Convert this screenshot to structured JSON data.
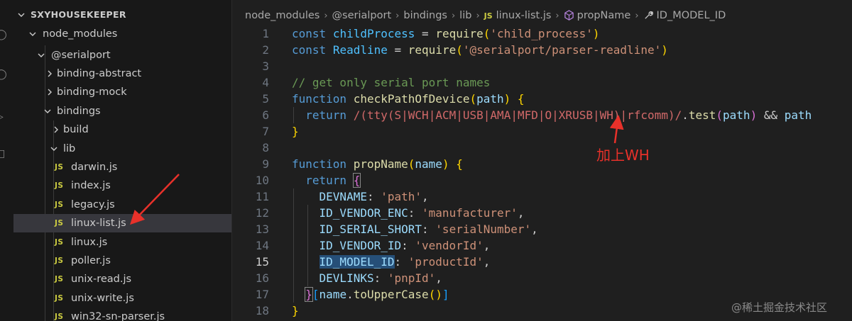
{
  "explorer": {
    "root": "SXYHOUSEKEEPER",
    "items": [
      {
        "label": "node_modules",
        "kind": "folder",
        "expanded": true
      },
      {
        "label": "@serialport",
        "kind": "folder",
        "expanded": true
      },
      {
        "label": "binding-abstract",
        "kind": "folder",
        "expanded": false
      },
      {
        "label": "binding-mock",
        "kind": "folder",
        "expanded": false
      },
      {
        "label": "bindings",
        "kind": "folder",
        "expanded": true
      },
      {
        "label": "build",
        "kind": "folder",
        "expanded": false
      },
      {
        "label": "lib",
        "kind": "folder",
        "expanded": true
      },
      {
        "label": "darwin.js",
        "kind": "file",
        "badge": "JS"
      },
      {
        "label": "index.js",
        "kind": "file",
        "badge": "JS"
      },
      {
        "label": "legacy.js",
        "kind": "file",
        "badge": "JS"
      },
      {
        "label": "linux-list.js",
        "kind": "file",
        "badge": "JS",
        "selected": true
      },
      {
        "label": "linux.js",
        "kind": "file",
        "badge": "JS"
      },
      {
        "label": "poller.js",
        "kind": "file",
        "badge": "JS"
      },
      {
        "label": "unix-read.js",
        "kind": "file",
        "badge": "JS"
      },
      {
        "label": "unix-write.js",
        "kind": "file",
        "badge": "JS"
      },
      {
        "label": "win32-sn-parser.js",
        "kind": "file",
        "badge": "JS"
      }
    ]
  },
  "breadcrumb": {
    "items": [
      "node_modules",
      "@serialport",
      "bindings",
      "lib"
    ],
    "file_badge": "JS",
    "file": "linux-list.js",
    "symbol": "propName",
    "property": "ID_MODEL_ID"
  },
  "editor": {
    "line_numbers": [
      "1",
      "2",
      "3",
      "4",
      "5",
      "6",
      "7",
      "8",
      "9",
      "10",
      "11",
      "12",
      "13",
      "14",
      "15",
      "16",
      "17",
      "18"
    ],
    "current_line": "15"
  },
  "annotation": {
    "text": "加上WH"
  },
  "watermark": "@稀土掘金技术社区",
  "colors": {
    "accent_annotation": "#e8312a",
    "selection": "#264f78",
    "sidebar_selected": "#37373d"
  }
}
